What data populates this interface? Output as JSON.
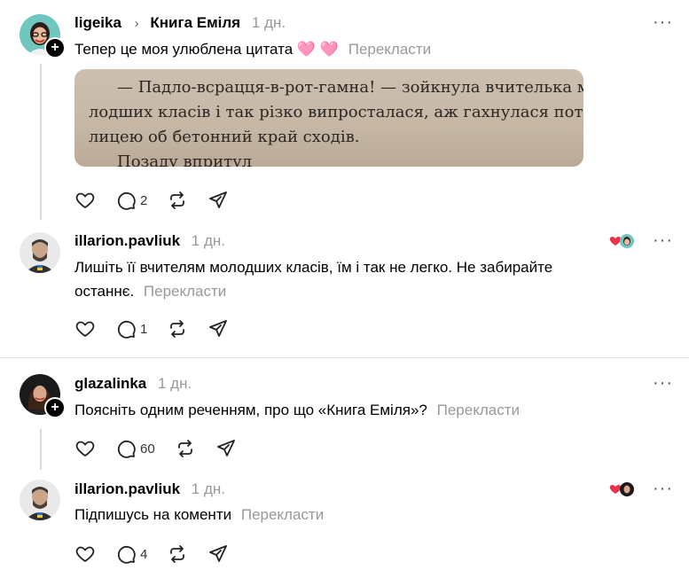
{
  "posts": [
    {
      "username": "ligeika",
      "topic": "Книга Еміля",
      "time": "1 дн.",
      "text": "Тепер це моя улюблена цитата",
      "emoji": "🩷 🩷",
      "translate": "Перекласти",
      "quote_lines": [
        "Падло-всрацця-в-рот-гамна! — зойкнула вчителька мо-",
        "лодших класів і так різко випросталася, аж гахнулася поти-",
        "лицею об бетонний край сходів.",
        "Позаду впритул"
      ],
      "quote_dash": "—",
      "replies": "2",
      "more": "···"
    },
    {
      "username": "illarion.pavliuk",
      "time": "1 дн.",
      "text_line1": "Лишіть її вчителям молодших класів, їм і так не легко. Не забирайте",
      "text_line2": "останнє.",
      "translate": "Перекласти",
      "replies": "1",
      "more": "···"
    },
    {
      "username": "glazalinka",
      "time": "1 дн.",
      "text": "Поясніть одним реченням, про що «Книга Еміля»?",
      "translate": "Перекласти",
      "replies": "60",
      "more": "···"
    },
    {
      "username": "illarion.pavliuk",
      "time": "1 дн.",
      "text": "Підпишусь на коменти",
      "translate": "Перекласти",
      "replies": "4",
      "more": "···"
    }
  ],
  "icons": [
    "heart-icon",
    "comment-icon",
    "repost-icon",
    "share-icon",
    "more-icon",
    "plus-icon",
    "chevron-right-icon"
  ],
  "colors": {
    "like_red": "#e8334a",
    "muted": "#999999",
    "divider": "#e3e3e3"
  }
}
